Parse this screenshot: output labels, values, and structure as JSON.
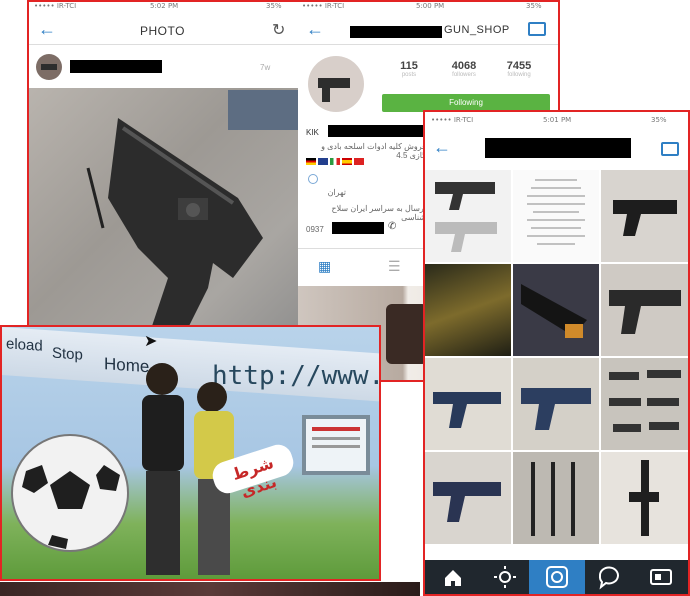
{
  "colors": {
    "ios_blue": "#2f7fc4",
    "following_green": "#5ab342",
    "frame_red": "#e22424"
  },
  "photo_screen": {
    "status_left": "••••• IR-TCI",
    "status_time": "5:02 PM",
    "status_right": "35%",
    "title": "PHOTO",
    "time_ago": "7w",
    "icons": [
      "back-arrow-icon",
      "refresh-icon"
    ]
  },
  "profile_screen": {
    "status_left": "••••• IR-TCI",
    "status_time": "5:00 PM",
    "status_right": "35%",
    "username_suffix": "GUN_SHOP",
    "stats": [
      {
        "value": "115",
        "label": "posts"
      },
      {
        "value": "4068",
        "label": "followers"
      },
      {
        "value": "7455",
        "label": "following"
      }
    ],
    "follow_button": "Following",
    "bio_prefix": "KIK",
    "bio_line1": "فروش کلیه ادوات اسلحه بادی و گازی 4.5",
    "bio_location": "تهران",
    "bio_line3": "ارسال به سراسر ایران سلاح شناسی",
    "phone_prefix": "0937"
  },
  "grid_screen": {
    "status_left": "••••• IR-TCI",
    "status_time": "5:01 PM",
    "status_right": "35%",
    "tab_icons": [
      "home-icon",
      "explore-icon",
      "camera-icon",
      "activity-icon",
      "profile-icon"
    ]
  },
  "news_photo": {
    "browser_words": [
      "eload",
      "Stop",
      "Home"
    ],
    "url_text": "http://www.",
    "persian_label": "شرط بندی"
  }
}
